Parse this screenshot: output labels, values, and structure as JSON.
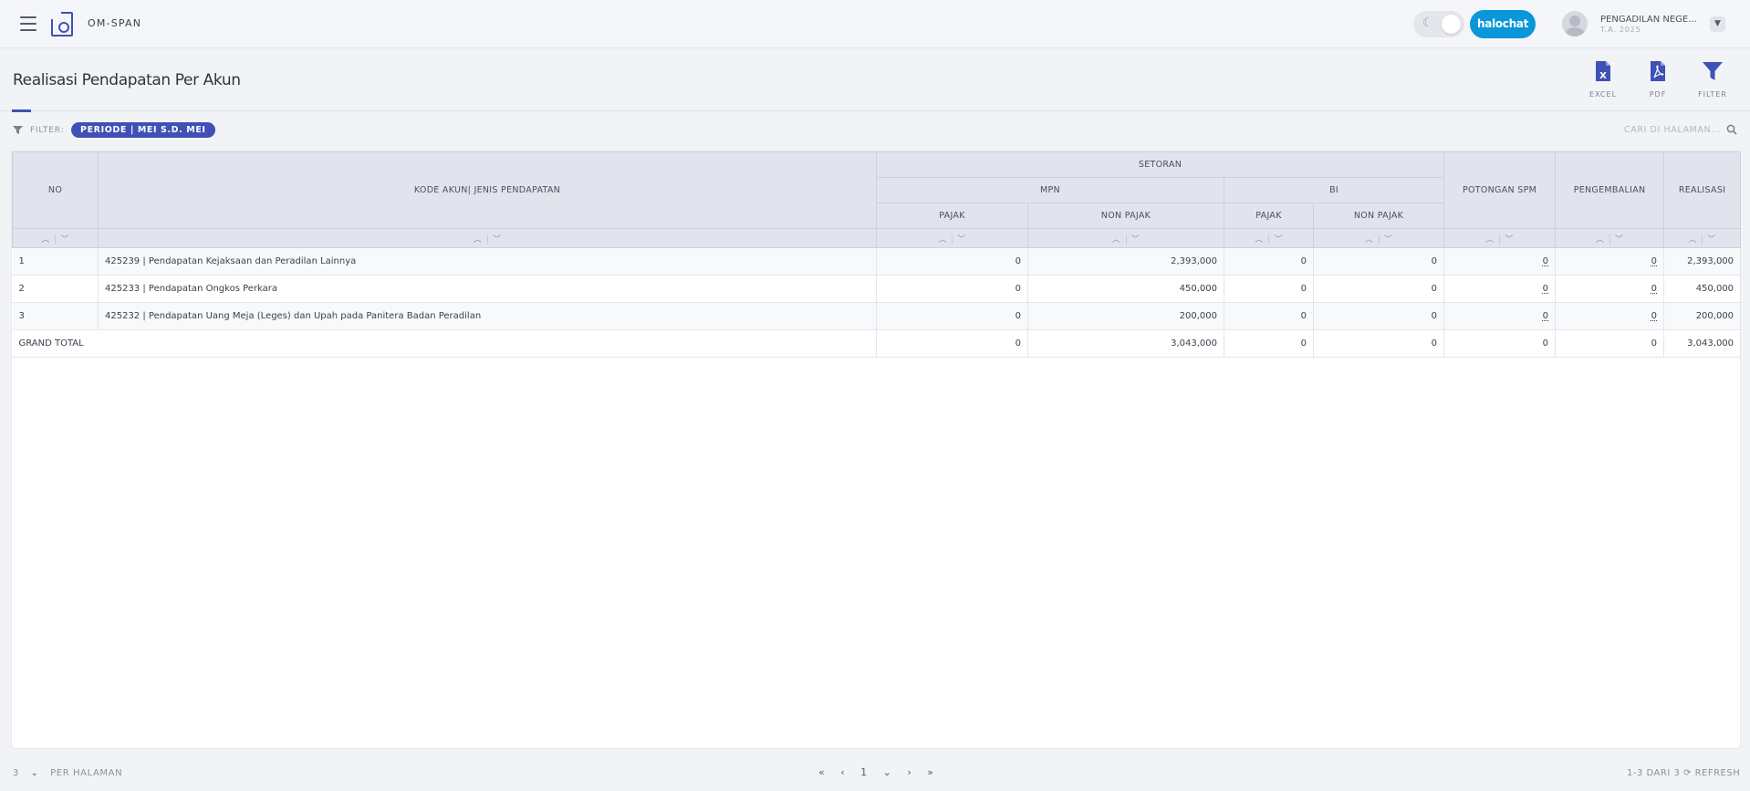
{
  "app": {
    "brand": "OM-SPAN"
  },
  "header": {
    "chat_button": "halochat",
    "user_name": "PENGADILAN NEGE...",
    "user_year": "T.A. 2025"
  },
  "page": {
    "title": "Realisasi Pendapatan Per Akun"
  },
  "tools": {
    "excel": "EXCEL",
    "pdf": "PDF",
    "filter": "FILTER"
  },
  "filterbar": {
    "label": "FILTER:",
    "chip": "PERIODE | MEI S.D. MEI",
    "search_placeholder": "CARI DI HALAMAN..."
  },
  "table": {
    "headers": {
      "no": "NO",
      "kode": "KODE AKUN| JENIS PENDAPATAN",
      "setoran": "SETORAN",
      "mpn": "MPN",
      "bi": "BI",
      "pajak": "PAJAK",
      "non_pajak": "NON PAJAK",
      "potongan": "POTONGAN SPM",
      "pengembalian": "PENGEMBALIAN",
      "realisasi": "REALISASI"
    },
    "rows": [
      {
        "no": "1",
        "kode": "425239 | Pendapatan Kejaksaan dan Peradilan Lainnya",
        "mpn_pajak": "0",
        "mpn_non": "2,393,000",
        "bi_pajak": "0",
        "bi_non": "0",
        "potongan": "0",
        "pengembalian": "0",
        "realisasi": "2,393,000"
      },
      {
        "no": "2",
        "kode": "425233 | Pendapatan Ongkos Perkara",
        "mpn_pajak": "0",
        "mpn_non": "450,000",
        "bi_pajak": "0",
        "bi_non": "0",
        "potongan": "0",
        "pengembalian": "0",
        "realisasi": "450,000"
      },
      {
        "no": "3",
        "kode": "425232 | Pendapatan Uang Meja (Leges) dan Upah pada Panitera Badan Peradilan",
        "mpn_pajak": "0",
        "mpn_non": "200,000",
        "bi_pajak": "0",
        "bi_non": "0",
        "potongan": "0",
        "pengembalian": "0",
        "realisasi": "200,000"
      }
    ],
    "total": {
      "label": "GRAND TOTAL",
      "mpn_pajak": "0",
      "mpn_non": "3,043,000",
      "bi_pajak": "0",
      "bi_non": "0",
      "potongan": "0",
      "pengembalian": "0",
      "realisasi": "3,043,000"
    }
  },
  "footer": {
    "page_size": "3",
    "per_page_label": "PER HALAMAN",
    "current_page": "1",
    "range": "1-3 DARI 3",
    "refresh": "REFRESH"
  }
}
